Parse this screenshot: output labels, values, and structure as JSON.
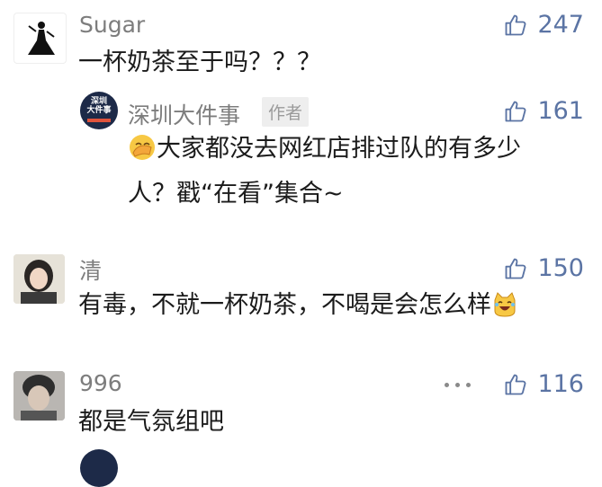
{
  "colors": {
    "name": "#7d7d7d",
    "text": "#1b1b1b",
    "like": "#5b74a4",
    "badge_bg": "#eeeeee"
  },
  "comments": [
    {
      "user": "Sugar",
      "likes": "247",
      "text": "一杯奶茶至于吗？？？",
      "reply": {
        "user": "深圳大件事",
        "badge": "作者",
        "likes": "161",
        "avatar_text_1": "深圳",
        "avatar_text_2": "大件事",
        "line1": "大家都没去网红店排过队的有多少",
        "line2": "人？戳“在看”集合~"
      }
    },
    {
      "user": "清",
      "likes": "150",
      "text": "有毒，不就一杯奶茶，不喝是会怎么样"
    },
    {
      "user": "996",
      "likes": "116",
      "text": "都是气氛组吧"
    }
  ],
  "icons": {
    "like": "thumbs-up-icon",
    "more": "more-dots-icon"
  }
}
